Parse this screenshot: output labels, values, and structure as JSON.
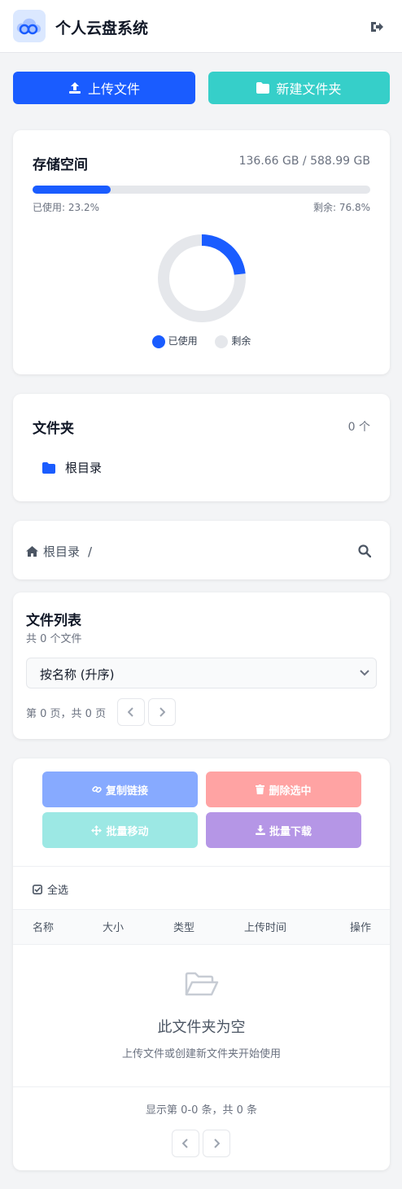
{
  "header": {
    "app_title": "个人云盘系统"
  },
  "toolbar": {
    "upload_label": "上传文件",
    "new_folder_label": "新建文件夹"
  },
  "storage": {
    "title": "存储空间",
    "usage_text": "136.66 GB / 588.99 GB",
    "used_text": "已使用: 23.2%",
    "free_text": "剩余: 76.8%",
    "used_fraction": 0.232,
    "legend_used": "已使用",
    "legend_free": "剩余",
    "colors": {
      "used": "#1a5cff",
      "free": "#e5e7eb"
    }
  },
  "folders": {
    "title": "文件夹",
    "count": "0 个",
    "root_label": "根目录"
  },
  "breadcrumb": {
    "root": "根目录",
    "separator": "/"
  },
  "filelist": {
    "title": "文件列表",
    "count_text": "共 0 个文件",
    "sort_value": "按名称 (升序)",
    "page_text": "第 0 页，共 0 页"
  },
  "actions": {
    "copy_link": "复制链接",
    "delete_selected": "删除选中",
    "batch_move": "批量移动",
    "batch_download": "批量下载",
    "select_all": "全选"
  },
  "table": {
    "columns": [
      "名称",
      "大小",
      "类型",
      "上传时间",
      "操作"
    ],
    "empty_title": "此文件夹为空",
    "empty_hint": "上传文件或创建新文件夹开始使用",
    "footer_text": "显示第 0-0 条，共 0 条"
  }
}
